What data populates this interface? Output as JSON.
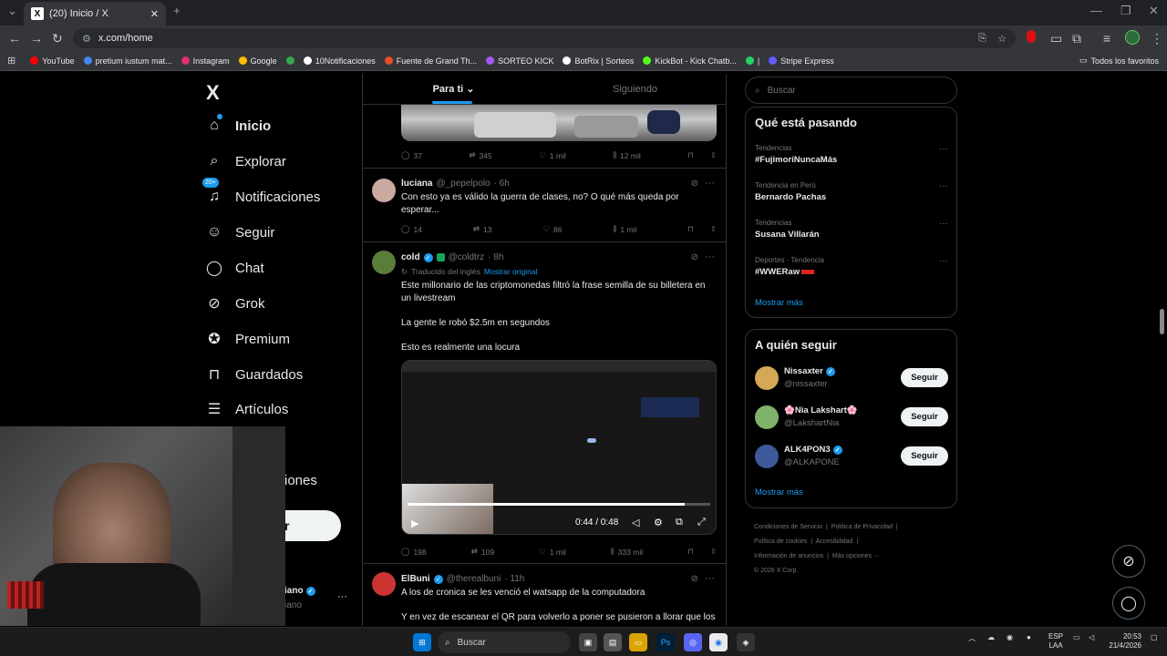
{
  "browser": {
    "tab_title": "(20) Inicio / X",
    "new_tab": "+",
    "url": "x.com/home",
    "bookmarks": [
      {
        "label": "YouTube",
        "color": "#ff0000"
      },
      {
        "label": "pretium iustum mat...",
        "color": "#4285f4"
      },
      {
        "label": "Instagram",
        "color": "#e1306c"
      },
      {
        "label": "Google",
        "color": "#4285f4"
      },
      {
        "label": "10Notificaciones",
        "color": "#ffffff"
      },
      {
        "label": "Fuente de Grand Th...",
        "color": "#e44d26"
      },
      {
        "label": "SORTEO KICK",
        "color": "#a855f7"
      },
      {
        "label": "BotRix | Sorteos",
        "color": "#ffffff"
      },
      {
        "label": "KickBot - Kick Chatb...",
        "color": "#53fc18"
      },
      {
        "label": "|",
        "color": "#25d366"
      },
      {
        "label": "Stripe Express",
        "color": "#635bff"
      }
    ],
    "all_bookmarks": "Todos los favoritos"
  },
  "nav": {
    "logo": "X",
    "items": [
      {
        "label": "Inicio",
        "icon": "home-icon"
      },
      {
        "label": "Explorar",
        "icon": "search-icon"
      },
      {
        "label": "Notificaciones",
        "icon": "bell-icon"
      },
      {
        "label": "Seguir",
        "icon": "add-user-icon"
      },
      {
        "label": "Chat",
        "icon": "chat-icon"
      },
      {
        "label": "Grok",
        "icon": "grok-icon"
      },
      {
        "label": "Premium",
        "icon": "premium-icon"
      },
      {
        "label": "Guardados",
        "icon": "bookmark-icon"
      },
      {
        "label": "Artículos",
        "icon": "articles-icon"
      }
    ],
    "notif_badge": "20+",
    "partial_label": "iones",
    "partial_button": "r",
    "partial_user": "iano",
    "partial_handle": "iano",
    "more": "···"
  },
  "feed": {
    "tabs": [
      "Para ti",
      "Siguiendo"
    ],
    "tweets": [
      {
        "replies": "37",
        "reposts": "345",
        "likes": "1 mil",
        "views": "12 mil"
      },
      {
        "name": "luciana",
        "handle": "@_pepelpolo",
        "time": "· 6h",
        "text": "Con esto ya es válido la guerra de clases, no? O qué más queda por esperar...",
        "replies": "14",
        "reposts": "13",
        "likes": "86",
        "views": "1 mil"
      },
      {
        "name": "cold",
        "handle": "@coldtrz",
        "time": "· 8h",
        "translated": "Traducido del inglés",
        "show_original": "Mostrar original",
        "text1": "Este millonario de las criptomonedas filtró la frase semilla de su billetera en un livestream",
        "text2": "La gente le robó $2.5m en segundos",
        "text3": "Esto es realmente una locura",
        "video_time": "0:44 / 0:48",
        "video_progress": 0.917,
        "replies": "198",
        "reposts": "109",
        "likes": "1 mil",
        "views": "333 mil"
      },
      {
        "name": "ElBuni",
        "handle": "@therealbuni",
        "time": "· 11h",
        "text1": "A los de cronica se les venció el watsapp de la computadora",
        "text2": "Y en vez de escanear el QR para volverlo a poner se pusieron a llorar que los HACKEARON DESDE EL GOBIERNO PARA CENSURAR"
      }
    ]
  },
  "right": {
    "search_placeholder": "Buscar",
    "trends_title": "Qué está pasando",
    "trends": [
      {
        "category": "Tendencias",
        "name": "#FujimoriNuncaMás"
      },
      {
        "category": "Tendencia en Perú",
        "name": "Bernardo Pachas"
      },
      {
        "category": "Tendencias",
        "name": "Susana Villarán"
      },
      {
        "category": "Deportes · Tendencia",
        "name": "#WWERaw"
      }
    ],
    "show_more": "Mostrar más",
    "follow_title": "A quién seguir",
    "follows": [
      {
        "name": "Nissaxter",
        "handle": "@nissaxter",
        "verified": true,
        "color": "#d4a857"
      },
      {
        "name": "🌸Nia Lakshart🌸",
        "handle": "@LakshartNia",
        "verified": false,
        "color": "#7fb26b"
      },
      {
        "name": "ALK4PON3",
        "handle": "@ALKAPONE",
        "verified": true,
        "color": "#3c5a9a"
      }
    ],
    "follow_button": "Seguir",
    "footer": [
      "Condiciones de Servicio",
      "Política de Privacidad",
      "Política de cookies",
      "Accesibilidad",
      "Información de anuncios",
      "Más opciones ···",
      "© 2026 X Corp."
    ]
  },
  "taskbar": {
    "search": "Buscar",
    "lang1": "ESP",
    "lang2": "LAA",
    "time": "20:53",
    "date": "21/4/2026"
  }
}
